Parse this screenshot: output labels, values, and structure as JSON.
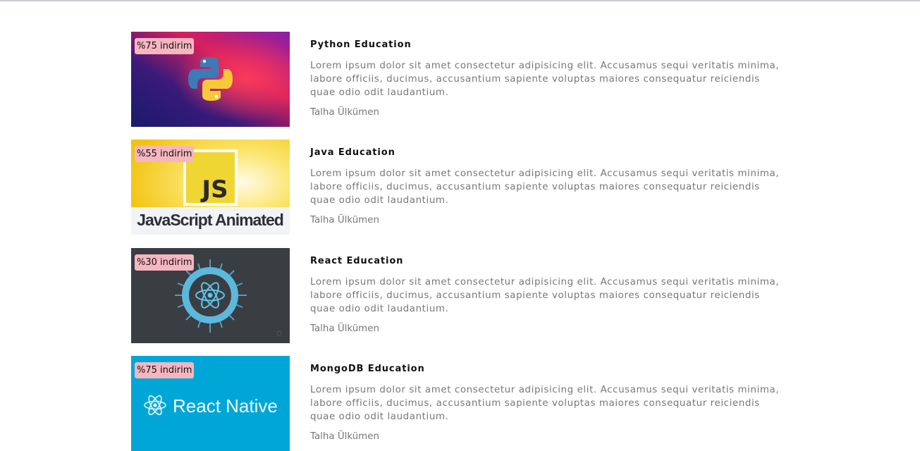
{
  "courses": [
    {
      "badge": "%75 indirim",
      "title": "Python Education",
      "description": "Lorem ipsum dolor sit amet consectetur adipisicing elit. Accusamus sequi veritatis minima, labore officiis, ducimus, accusantium sapiente voluptas maiores consequatur reiciendis quae odio odit laudantium.",
      "author": "Talha Ülkümen",
      "thumbnail_icon": "python-logo-icon"
    },
    {
      "badge": "%55 indirim",
      "title": "Java Education",
      "description": "Lorem ipsum dolor sit amet consectetur adipisicing elit. Accusamus sequi veritatis minima, labore officiis, ducimus, accusantium sapiente voluptas maiores consequatur reiciendis quae odio odit laudantium.",
      "author": "Talha Ülkümen",
      "thumbnail_icon": "javascript-logo-icon",
      "thumbnail_text": {
        "logo": "JS",
        "caption": "JavaScript Animated"
      }
    },
    {
      "badge": "%30 indirim",
      "title": "React Education",
      "description": "Lorem ipsum dolor sit amet consectetur adipisicing elit. Accusamus sequi veritatis minima, labore officiis, ducimus, accusantium sapiente voluptas maiores consequatur reiciendis quae odio odit laudantium.",
      "author": "Talha Ülkümen",
      "thumbnail_icon": "react-atom-icon"
    },
    {
      "badge": "%75 indirim",
      "title": "MongoDB Education",
      "description": "Lorem ipsum dolor sit amet consectetur adipisicing elit. Accusamus sequi veritatis minima, labore officiis, ducimus, accusantium sapiente voluptas maiores consequatur reiciendis quae odio odit laudantium.",
      "author": "Talha Ülkümen",
      "thumbnail_icon": "react-native-logo-icon",
      "thumbnail_text": {
        "caption": "React Native"
      }
    }
  ],
  "colors": {
    "badge_bg": "#f6b6c0",
    "title": "#111111",
    "body_text": "#777777",
    "react_blue": "#61dafb",
    "react_native_bg": "#00a7d6",
    "js_yellow": "#f7df1e"
  }
}
